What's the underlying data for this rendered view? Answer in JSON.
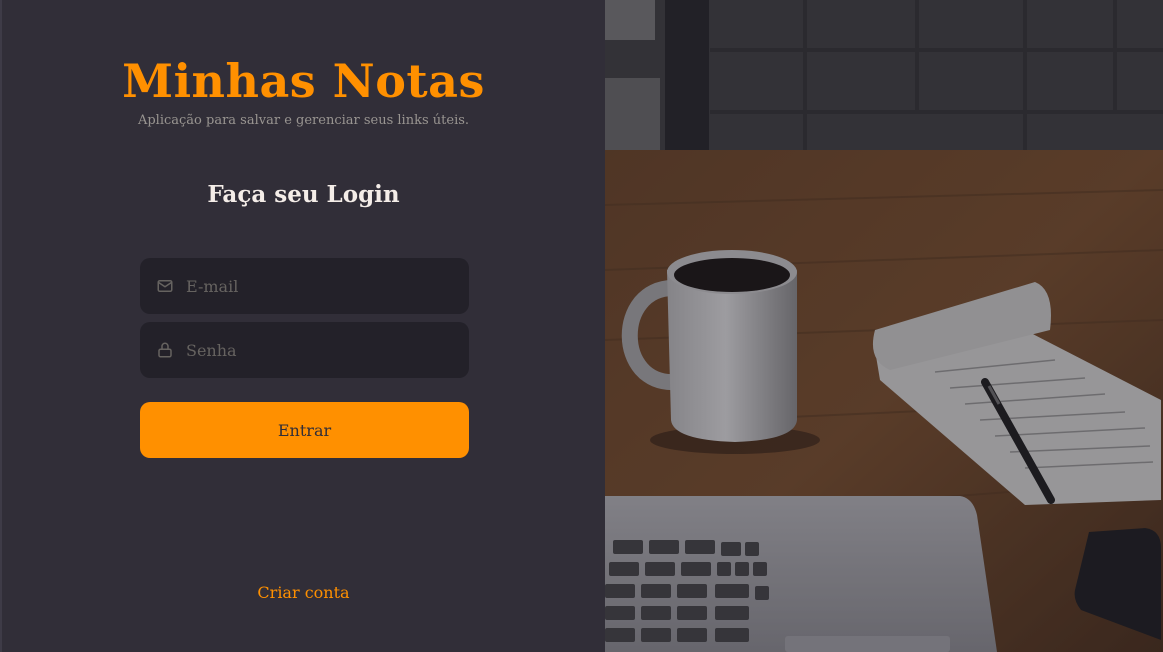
{
  "brand": {
    "title": "Minhas Notas",
    "subtitle": "Aplicação para salvar e gerenciar seus links úteis."
  },
  "login": {
    "heading": "Faça seu Login",
    "email_placeholder": "E-mail",
    "password_placeholder": "Senha",
    "submit_label": "Entrar",
    "create_account_label": "Criar conta"
  },
  "icons": {
    "email": "mail-icon",
    "password": "lock-icon"
  },
  "colors": {
    "background": "#312e38",
    "accent": "#ff9000",
    "input_background": "#232129",
    "placeholder": "#666360",
    "heading_text": "#f4ede8",
    "subtitle_text": "#999591"
  }
}
